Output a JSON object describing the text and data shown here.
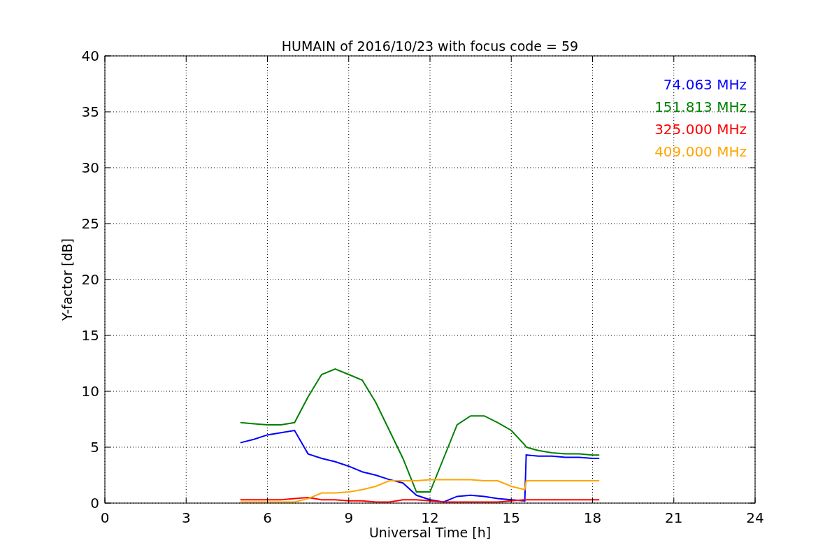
{
  "chart_data": {
    "type": "line",
    "title": "HUMAIN of 2016/10/23 with focus code = 59",
    "xlabel": "Universal Time [h]",
    "ylabel": "Y-factor [dB]",
    "x": [
      5,
      5.5,
      6,
      6.5,
      7,
      7.5,
      8,
      8.5,
      9,
      9.5,
      10,
      10.5,
      11,
      11.5,
      12,
      12.5,
      13,
      13.5,
      14,
      14.5,
      15,
      15.5,
      15.55,
      16,
      16.5,
      17,
      17.5,
      18,
      18.25
    ],
    "series": [
      {
        "name": "74.063 MHz",
        "color": "#0000ff",
        "values": [
          5.4,
          5.7,
          6.1,
          6.3,
          6.5,
          4.4,
          4.0,
          3.7,
          3.3,
          2.8,
          2.5,
          2.1,
          1.8,
          0.7,
          0.3,
          0.1,
          0.6,
          0.7,
          0.6,
          0.4,
          0.3,
          0.2,
          4.3,
          4.2,
          4.2,
          4.1,
          4.1,
          4.0,
          4.0
        ]
      },
      {
        "name": "151.813 MHz",
        "color": "#008000",
        "values": [
          7.2,
          7.1,
          7.0,
          7.0,
          7.2,
          9.5,
          11.5,
          12.0,
          11.5,
          11.0,
          9.0,
          6.5,
          4.0,
          1.0,
          1.0,
          4.0,
          7.0,
          7.8,
          7.8,
          7.2,
          6.5,
          5.2,
          5.0,
          4.7,
          4.5,
          4.4,
          4.4,
          4.3,
          4.3
        ]
      },
      {
        "name": "325.000 MHz",
        "color": "#ff0000",
        "values": [
          0.3,
          0.3,
          0.3,
          0.3,
          0.4,
          0.5,
          0.3,
          0.3,
          0.2,
          0.2,
          0.1,
          0.1,
          0.3,
          0.3,
          0.2,
          0.1,
          0.1,
          0.1,
          0.1,
          0.1,
          0.2,
          0.3,
          0.3,
          0.3,
          0.3,
          0.3,
          0.3,
          0.3,
          0.3
        ]
      },
      {
        "name": "409.000 MHz",
        "color": "#ffa500",
        "values": [
          0.1,
          0.1,
          0.1,
          0.1,
          0.1,
          0.4,
          0.9,
          0.9,
          1.0,
          1.2,
          1.5,
          2.0,
          2.0,
          2.0,
          2.1,
          2.1,
          2.1,
          2.1,
          2.0,
          2.0,
          1.5,
          1.2,
          2.0,
          2.0,
          2.0,
          2.0,
          2.0,
          2.0,
          2.0
        ]
      }
    ],
    "xlim": [
      0,
      24
    ],
    "ylim": [
      0,
      40
    ],
    "xticks": [
      0,
      3,
      6,
      9,
      12,
      15,
      18,
      21,
      24
    ],
    "yticks": [
      0,
      5,
      10,
      15,
      20,
      25,
      30,
      35,
      40
    ],
    "grid": true
  }
}
